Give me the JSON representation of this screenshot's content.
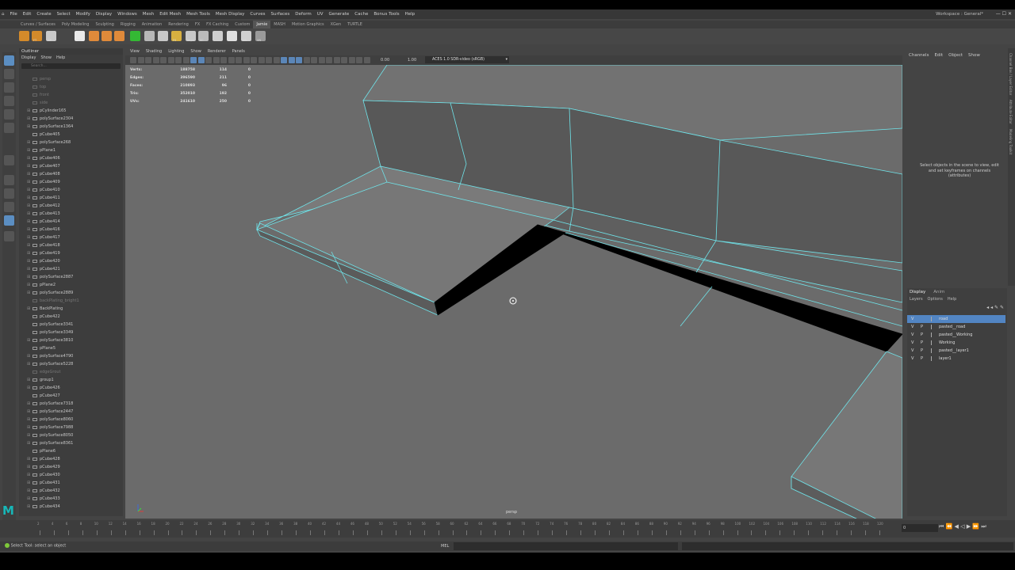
{
  "menubar": {
    "items": [
      "File",
      "Edit",
      "Create",
      "Select",
      "Modify",
      "Display",
      "Windows",
      "Mesh",
      "Edit Mesh",
      "Mesh Tools",
      "Mesh Display",
      "Curves",
      "Surfaces",
      "Deform",
      "UV",
      "Generate",
      "Cache",
      "Bonus Tools",
      "Help"
    ],
    "workspace_label": "Workspace :",
    "workspace_value": "General*"
  },
  "shelf_tabs": {
    "items": [
      "Curves / Surfaces",
      "Poly Modeling",
      "Sculpting",
      "Rigging",
      "Animation",
      "Rendering",
      "FX",
      "FX Caching",
      "Custom",
      "Jamie",
      "MASH",
      "Motion Graphics",
      "XGen",
      "TURTLE"
    ],
    "active": "Jamie"
  },
  "shelf": {
    "labels": [
      "FT",
      "CP",
      "Hist",
      "",
      "",
      "",
      "",
      "",
      "",
      "FS",
      "Impo",
      "SC",
      "",
      "",
      "N5",
      "VN"
    ]
  },
  "outliner": {
    "title": "Outliner",
    "menu": [
      "Display",
      "Show",
      "Help"
    ],
    "search_placeholder": "Search...",
    "items": [
      {
        "label": "persp",
        "grey": true,
        "exp": false
      },
      {
        "label": "top",
        "grey": true,
        "exp": false
      },
      {
        "label": "front",
        "grey": true,
        "exp": false
      },
      {
        "label": "side",
        "grey": true,
        "exp": false
      },
      {
        "label": "pCylinder165",
        "grey": false,
        "exp": true
      },
      {
        "label": "polySurface2304",
        "grey": false,
        "exp": true
      },
      {
        "label": "polySurface1364",
        "grey": false,
        "exp": true
      },
      {
        "label": "pCube405",
        "grey": false,
        "exp": false
      },
      {
        "label": "polySurface268",
        "grey": false,
        "exp": true
      },
      {
        "label": "pPlane1",
        "grey": false,
        "exp": true
      },
      {
        "label": "pCube406",
        "grey": false,
        "exp": true
      },
      {
        "label": "pCube407",
        "grey": false,
        "exp": true
      },
      {
        "label": "pCube408",
        "grey": false,
        "exp": true
      },
      {
        "label": "pCube409",
        "grey": false,
        "exp": true
      },
      {
        "label": "pCube410",
        "grey": false,
        "exp": true
      },
      {
        "label": "pCube411",
        "grey": false,
        "exp": true
      },
      {
        "label": "pCube412",
        "grey": false,
        "exp": true
      },
      {
        "label": "pCube413",
        "grey": false,
        "exp": true
      },
      {
        "label": "pCube414",
        "grey": false,
        "exp": true
      },
      {
        "label": "pCube416",
        "grey": false,
        "exp": true
      },
      {
        "label": "pCube417",
        "grey": false,
        "exp": true
      },
      {
        "label": "pCube418",
        "grey": false,
        "exp": true
      },
      {
        "label": "pCube419",
        "grey": false,
        "exp": true
      },
      {
        "label": "pCube420",
        "grey": false,
        "exp": true
      },
      {
        "label": "pCube421",
        "grey": false,
        "exp": true
      },
      {
        "label": "polySurface2887",
        "grey": false,
        "exp": true
      },
      {
        "label": "pPlane2",
        "grey": false,
        "exp": true
      },
      {
        "label": "polySurface2889",
        "grey": false,
        "exp": true
      },
      {
        "label": "backPlating_bright1",
        "grey": true,
        "exp": false
      },
      {
        "label": "BackPlating",
        "grey": false,
        "exp": true
      },
      {
        "label": "pCube422",
        "grey": false,
        "exp": false
      },
      {
        "label": "polySurface3341",
        "grey": false,
        "exp": false
      },
      {
        "label": "polySurface3349",
        "grey": false,
        "exp": false
      },
      {
        "label": "polySurface3810",
        "grey": false,
        "exp": true
      },
      {
        "label": "pPlane5",
        "grey": false,
        "exp": false
      },
      {
        "label": "polySurface4790",
        "grey": false,
        "exp": true
      },
      {
        "label": "polySurface5228",
        "grey": false,
        "exp": true
      },
      {
        "label": "edgeGrout",
        "grey": true,
        "exp": false
      },
      {
        "label": "group1",
        "grey": false,
        "exp": true
      },
      {
        "label": "pCube426",
        "grey": false,
        "exp": true
      },
      {
        "label": "pCube427",
        "grey": false,
        "exp": false
      },
      {
        "label": "polySurface7318",
        "grey": false,
        "exp": true
      },
      {
        "label": "polySurface2447",
        "grey": false,
        "exp": true
      },
      {
        "label": "polySurface8060",
        "grey": false,
        "exp": true
      },
      {
        "label": "polySurface7988",
        "grey": false,
        "exp": true
      },
      {
        "label": "polySurface8050",
        "grey": false,
        "exp": true
      },
      {
        "label": "polySurface8361",
        "grey": false,
        "exp": true
      },
      {
        "label": "pPlane6",
        "grey": false,
        "exp": false
      },
      {
        "label": "pCube428",
        "grey": false,
        "exp": true
      },
      {
        "label": "pCube429",
        "grey": false,
        "exp": true
      },
      {
        "label": "pCube430",
        "grey": false,
        "exp": true
      },
      {
        "label": "pCube431",
        "grey": false,
        "exp": true
      },
      {
        "label": "pCube432",
        "grey": false,
        "exp": true
      },
      {
        "label": "pCube433",
        "grey": false,
        "exp": true
      },
      {
        "label": "pCube434",
        "grey": false,
        "exp": true
      }
    ]
  },
  "viewport": {
    "menu": [
      "View",
      "Shading",
      "Lighting",
      "Show",
      "Renderer",
      "Panels"
    ],
    "field_a": "0.00",
    "field_b": "1.00",
    "colorspace": "ACES 1.0 SDR-video (sRGB)",
    "hud": [
      {
        "label": "Verts:",
        "a": "188758",
        "b": "114",
        "c": "0"
      },
      {
        "label": "Edges:",
        "a": "396590",
        "b": "211",
        "c": "0"
      },
      {
        "label": "Faces:",
        "a": "210893",
        "b": "96",
        "c": "0"
      },
      {
        "label": "Tris:",
        "a": "352010",
        "b": "192",
        "c": "0"
      },
      {
        "label": "UVs:",
        "a": "241610",
        "b": "250",
        "c": "0"
      }
    ],
    "camera_label": "persp"
  },
  "channel_box": {
    "menu": [
      "Channels",
      "Edit",
      "Object",
      "Show"
    ],
    "message": "Select objects in the scene to view, edit and set keyframes on channels (attributes)"
  },
  "side_tabs": [
    "Channel Box / Layer Editor",
    "Attribute Editor",
    "Modeling Toolkit"
  ],
  "layer_editor": {
    "tabs": [
      "Display",
      "Anim"
    ],
    "menu": [
      "Layers",
      "Options",
      "Help"
    ],
    "layers": [
      {
        "v": "V",
        "p": "",
        "name": "road",
        "selected": true
      },
      {
        "v": "V",
        "p": "P",
        "name": "pasted__road",
        "selected": false
      },
      {
        "v": "V",
        "p": "P",
        "name": "pasted__Working",
        "selected": false
      },
      {
        "v": "V",
        "p": "P",
        "name": "Working",
        "selected": false
      },
      {
        "v": "V",
        "p": "P",
        "name": "pasted__layer1",
        "selected": false
      },
      {
        "v": "V",
        "p": "P",
        "name": "layer1",
        "selected": false
      }
    ]
  },
  "timeline": {
    "current_frame": "0",
    "ticks": [
      "2",
      "4",
      "6",
      "8",
      "10",
      "12",
      "14",
      "16",
      "18",
      "20",
      "22",
      "24",
      "26",
      "28",
      "30",
      "32",
      "34",
      "36",
      "38",
      "40",
      "42",
      "44",
      "46",
      "48",
      "50",
      "52",
      "54",
      "56",
      "58",
      "60",
      "62",
      "64",
      "66",
      "68",
      "70",
      "72",
      "74",
      "76",
      "78",
      "80",
      "82",
      "84",
      "86",
      "88",
      "90",
      "92",
      "94",
      "96",
      "98",
      "100",
      "102",
      "104",
      "106",
      "108",
      "110",
      "112",
      "114",
      "116",
      "118",
      "120"
    ]
  },
  "status": {
    "help_text": "Select Tool: select an object",
    "mel_label": "MEL"
  },
  "colors": {
    "accent": "#5285c3",
    "wire": "#6fe4ea",
    "viewport_bg": "#6b6b6b",
    "maya_logo": "#17b7b8"
  }
}
